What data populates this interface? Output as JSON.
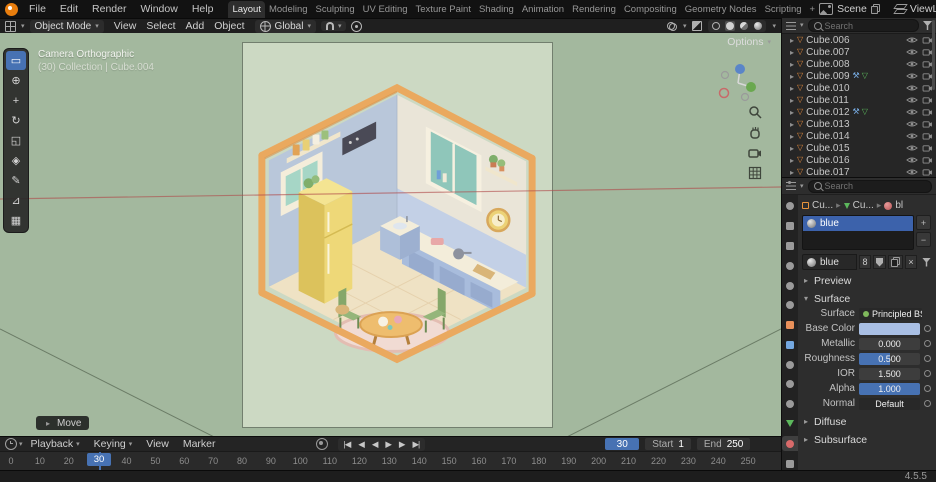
{
  "colors": {
    "accent": "#4772b3",
    "selection_orange": "#e8953c",
    "viewport_bg": "#a3b89e",
    "camera_bg": "#ccd9c3"
  },
  "icons": {
    "chevron_down": "▾",
    "arrow_right": "▸",
    "arrow_down": "▾",
    "disclosure": "▸",
    "mesh": "▽",
    "modifier_wrench": "⚒",
    "display_mod": "▽",
    "close": "×",
    "plus": "+",
    "minus": "−"
  },
  "topbar": {
    "menus": [
      "File",
      "Edit",
      "Render",
      "Window",
      "Help"
    ],
    "tabs": [
      {
        "label": "Layout",
        "active": true
      },
      {
        "label": "Modeling"
      },
      {
        "label": "Sculpting"
      },
      {
        "label": "UV Editing"
      },
      {
        "label": "Texture Paint"
      },
      {
        "label": "Shading"
      },
      {
        "label": "Animation"
      },
      {
        "label": "Rendering"
      },
      {
        "label": "Compositing"
      },
      {
        "label": "Geometry Nodes"
      },
      {
        "label": "Scripting"
      },
      {
        "label": "+"
      }
    ],
    "scene_label": "Scene",
    "viewlayer_label": "ViewLayer"
  },
  "viewport_header": {
    "mode": "Object Mode",
    "menus": [
      "View",
      "Select",
      "Add",
      "Object"
    ],
    "orientation": "Global",
    "options": "Options"
  },
  "viewport": {
    "camera_label": "Camera Orthographic",
    "context_label": "(30) Collection | Cube.004",
    "operator": "Move"
  },
  "tools": [
    {
      "name": "select-box-tool",
      "glyph": "▭",
      "active": true
    },
    {
      "name": "cursor-tool",
      "glyph": "⊕"
    },
    {
      "name": "move-tool",
      "glyph": "+"
    },
    {
      "name": "rotate-tool",
      "glyph": "↻"
    },
    {
      "name": "scale-tool",
      "glyph": "◱"
    },
    {
      "name": "transform-tool",
      "glyph": "◈"
    },
    {
      "name": "annotate-tool",
      "glyph": "✎"
    },
    {
      "name": "measure-tool",
      "glyph": "⊿"
    },
    {
      "name": "add-cube-tool",
      "glyph": "▦"
    }
  ],
  "outliner": {
    "search_placeholder": "Search",
    "items": [
      {
        "name": "Cube.006"
      },
      {
        "name": "Cube.007"
      },
      {
        "name": "Cube.008"
      },
      {
        "name": "Cube.009",
        "mod": true
      },
      {
        "name": "Cube.010"
      },
      {
        "name": "Cube.011"
      },
      {
        "name": "Cube.012",
        "mod": true
      },
      {
        "name": "Cube.013"
      },
      {
        "name": "Cube.014"
      },
      {
        "name": "Cube.015"
      },
      {
        "name": "Cube.016"
      },
      {
        "name": "Cube.017"
      }
    ]
  },
  "prop_tabs": [
    {
      "name": "tool",
      "color": "#9a9a9a",
      "shape": "circle"
    },
    {
      "name": "render",
      "color": "#9a9a9a",
      "shape": "square"
    },
    {
      "name": "output",
      "color": "#9a9a9a",
      "shape": "square"
    },
    {
      "name": "view-layer",
      "color": "#9a9a9a",
      "shape": "circle"
    },
    {
      "name": "scene",
      "color": "#9a9a9a",
      "shape": "circle"
    },
    {
      "name": "world",
      "color": "#9a9a9a",
      "shape": "circle"
    },
    {
      "name": "object",
      "color": "#e8905a",
      "shape": "square"
    },
    {
      "name": "modifiers",
      "color": "#74a8e0",
      "shape": "square"
    },
    {
      "name": "particles",
      "color": "#9a9a9a",
      "shape": "circle"
    },
    {
      "name": "physics",
      "color": "#9a9a9a",
      "shape": "circle"
    },
    {
      "name": "constraints",
      "color": "#9a9a9a",
      "shape": "circle"
    },
    {
      "name": "data",
      "color": "#5cb85c",
      "shape": "triangle"
    },
    {
      "name": "material",
      "color": "#d86a6a",
      "shape": "circle",
      "active": true
    },
    {
      "name": "texture",
      "color": "#9a9a9a",
      "shape": "square"
    }
  ],
  "properties": {
    "search_placeholder": "Search",
    "breadcrumb": [
      {
        "label": "Cu..."
      },
      {
        "label": "Cu..."
      },
      {
        "label": "bl"
      }
    ],
    "slot": {
      "name": "blue"
    },
    "material": {
      "name": "blue",
      "users": "8"
    },
    "panels": {
      "preview": "Preview",
      "surface": "Surface",
      "diffuse": "Diffuse",
      "subsurface": "Subsurface"
    },
    "surface": {
      "rows": [
        {
          "label": "Surface",
          "value": "Principled BSDF"
        },
        {
          "label": "Base Color",
          "value": ""
        },
        {
          "label": "Metallic",
          "value": "0.000",
          "fill": 0
        },
        {
          "label": "Roughness",
          "value": "0.500",
          "fill": 0.5
        },
        {
          "label": "IOR",
          "value": "1.500",
          "fill": 0
        },
        {
          "label": "Alpha",
          "value": "1.000",
          "fill": 1
        },
        {
          "label": "Normal",
          "value": "Default"
        }
      ]
    }
  },
  "timeline": {
    "menus": [
      "Playback",
      "Keying",
      "View",
      "Marker"
    ],
    "playback_icons": [
      "|◀",
      "◀",
      "◀",
      "▶",
      "▶",
      "▶|"
    ],
    "current_frame": "30",
    "start_label": "Start",
    "start_value": "1",
    "end_label": "End",
    "end_value": "250",
    "ticks": [
      "0",
      "10",
      "20",
      "30",
      "40",
      "50",
      "60",
      "70",
      "80",
      "90",
      "100",
      "110",
      "120",
      "130",
      "140",
      "150",
      "160",
      "170",
      "180",
      "190",
      "200",
      "210",
      "220",
      "230",
      "240",
      "250"
    ]
  },
  "status": {
    "version": "4.5.5"
  }
}
